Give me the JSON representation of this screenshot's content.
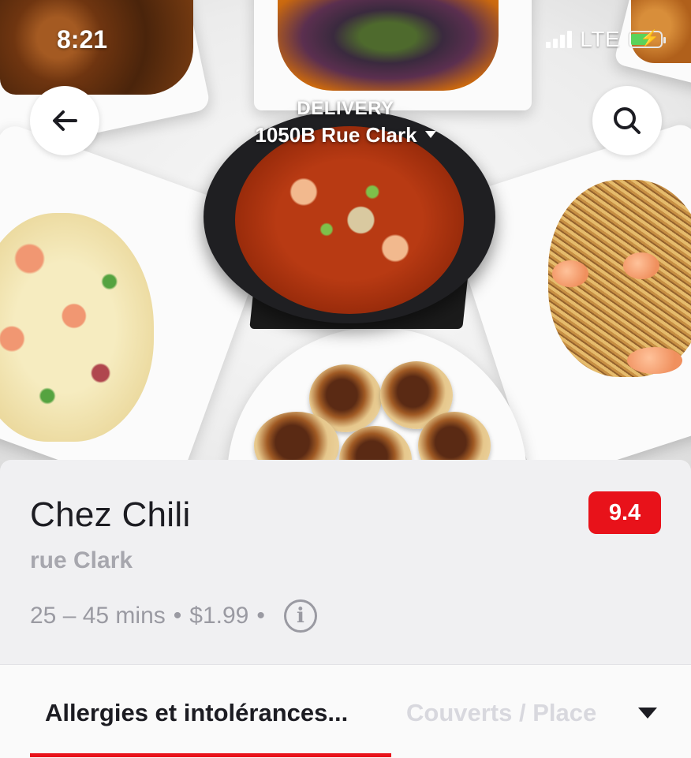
{
  "status_bar": {
    "time": "8:21",
    "network": "LTE",
    "battery_level": 0.6,
    "charging": true
  },
  "header": {
    "back_icon": "arrow-left-icon",
    "search_icon": "search-icon",
    "delivery_label": "DELIVERY",
    "address": "1050B Rue Clark"
  },
  "restaurant": {
    "name": "Chez Chili",
    "rating": "9.4",
    "rating_color": "#e8121a",
    "location": "rue Clark",
    "eta": "25 – 45 mins",
    "separator": "•",
    "delivery_fee": "$1.99"
  },
  "tabs": {
    "items": [
      {
        "label": "Allergies et intolérances..."
      },
      {
        "label": "Couverts / Place"
      }
    ],
    "active_index": 0
  },
  "colors": {
    "accent": "#e8121a",
    "text_primary": "#1c1c22",
    "text_secondary": "#9a9aa2"
  }
}
